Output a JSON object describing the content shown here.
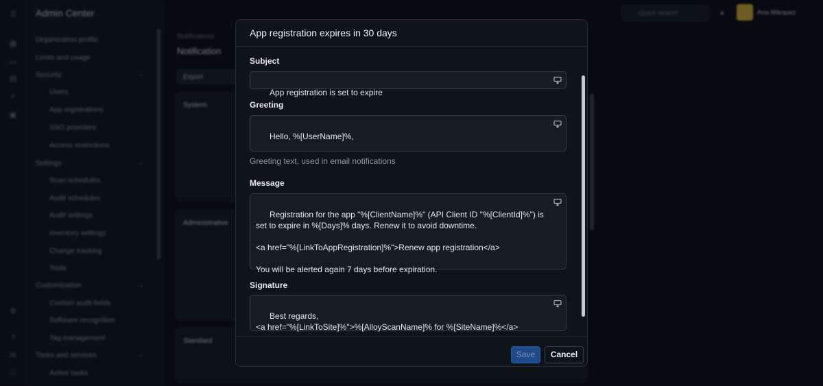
{
  "app": {
    "title": "Admin Center",
    "search_placeholder": "Quick search",
    "user_name": "Ana Márquez"
  },
  "sidebar": {
    "items": [
      {
        "label": "Organization profile"
      },
      {
        "label": "Limits and usage"
      },
      {
        "label": "Security"
      },
      {
        "label": "Users"
      },
      {
        "label": "App registrations"
      },
      {
        "label": "SSO providers"
      },
      {
        "label": "Access restrictions"
      },
      {
        "label": "Settings"
      },
      {
        "label": "Scan schedules"
      },
      {
        "label": "Audit schedules"
      },
      {
        "label": "Audit settings"
      },
      {
        "label": "Inventory settings"
      },
      {
        "label": "Change tracking"
      },
      {
        "label": "Tools"
      },
      {
        "label": "Customization"
      },
      {
        "label": "Custom audit fields"
      },
      {
        "label": "Software recognition"
      },
      {
        "label": "Tag management"
      },
      {
        "label": "Tasks and services"
      },
      {
        "label": "Active tasks"
      }
    ]
  },
  "page": {
    "breadcrumb": "Notifications",
    "title": "Notification",
    "export_label": "Export",
    "panels": [
      {
        "title": "System"
      },
      {
        "title": "Administrative"
      },
      {
        "title": "Standard"
      }
    ]
  },
  "modal": {
    "title": "App registration expires in 30 days",
    "fields": {
      "subject": {
        "label": "Subject",
        "value": "App registration is set to expire"
      },
      "greeting": {
        "label": "Greeting",
        "value": "Hello, %[UserName]%,",
        "helper": "Greeting text, used in email notifications"
      },
      "message": {
        "label": "Message",
        "value": "Registration for the app \"%[ClientName]%\" (API Client ID \"%[ClientId]%\") is set to expire in %[Days]% days. Renew it to avoid downtime.\n\n<a href=\"%[LinkToAppRegistration]%\">Renew app registration</a>\n\nYou will be alerted again 7 days before expiration."
      },
      "signature": {
        "label": "Signature",
        "value": "Best regards,\n<a href=\"%[LinkToSite]%\">%[AlloyScanName]% for %[SiteName]%</a>"
      }
    },
    "footer": {
      "save_label": "Save",
      "cancel_label": "Cancel"
    }
  },
  "colors": {
    "accent": "#1f4a8a",
    "background": "#0d1117",
    "modal": "#0f141b"
  }
}
